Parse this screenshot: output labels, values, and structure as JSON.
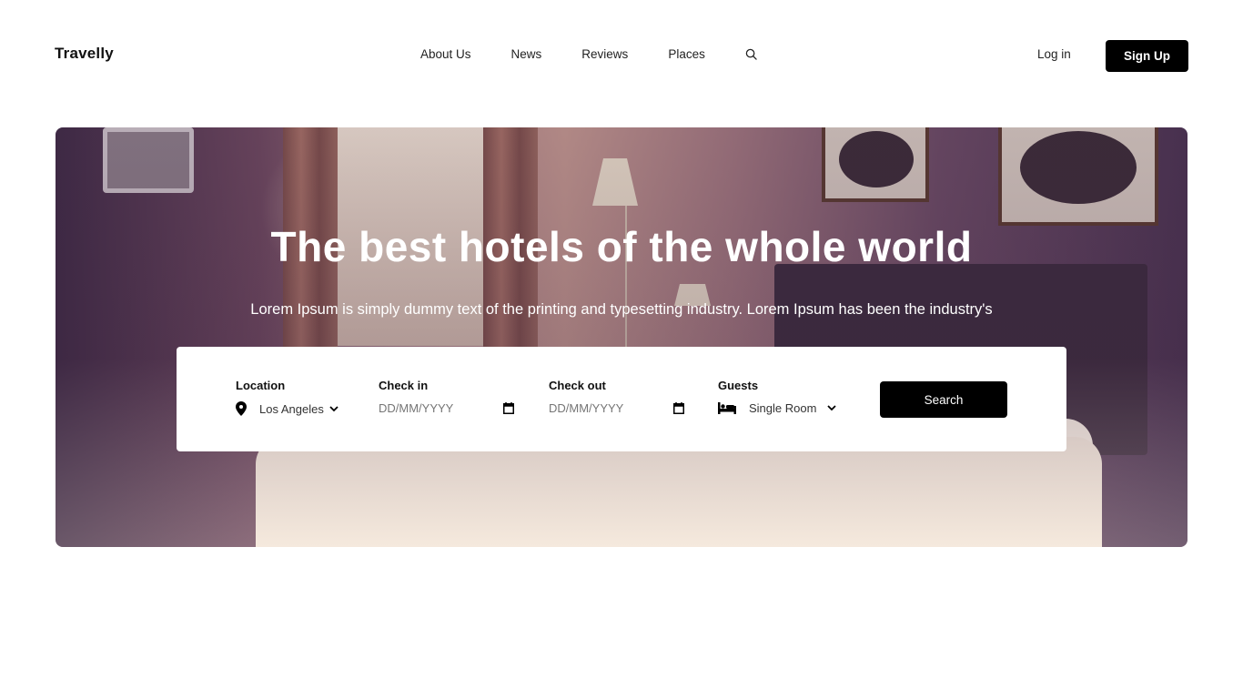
{
  "brand": {
    "name": "Travelly"
  },
  "nav": {
    "items": [
      {
        "label": "About Us"
      },
      {
        "label": "News"
      },
      {
        "label": "Reviews"
      },
      {
        "label": "Places"
      }
    ],
    "search_icon": "search-icon"
  },
  "auth": {
    "login_label": "Log in",
    "signup_label": "Sign Up"
  },
  "hero": {
    "title": "The best hotels of the whole world",
    "subtitle": "Lorem Ipsum is simply dummy text of the printing and typesetting industry. Lorem Ipsum has been the industry's"
  },
  "search_form": {
    "location": {
      "label": "Location",
      "value": "Los Angeles",
      "icon": "map-pin-icon"
    },
    "check_in": {
      "label": "Check in",
      "placeholder": "DD/MM/YYYY",
      "icon": "calendar-icon"
    },
    "check_out": {
      "label": "Check out",
      "placeholder": "DD/MM/YYYY",
      "icon": "calendar-icon"
    },
    "guests": {
      "label": "Guests",
      "value": "Single Room",
      "icon": "bed-icon"
    },
    "submit_label": "Search"
  },
  "colors": {
    "primary": "#000000",
    "background": "#ffffff",
    "text": "#111111"
  }
}
